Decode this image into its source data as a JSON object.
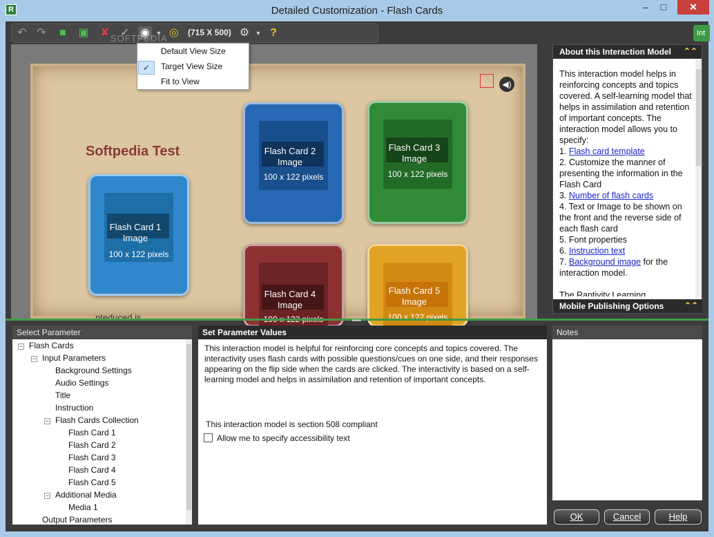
{
  "window": {
    "title": "Detailed Customization - Flash Cards",
    "icon_letter": "R",
    "min": "–",
    "max": "□",
    "close": "✕"
  },
  "toolbar": {
    "view_size": "(715 X 500)",
    "help_glyph": "?"
  },
  "side_tab": {
    "label": "Int"
  },
  "watermark": "SOFTPEDIA",
  "dropdown": {
    "items": [
      "Default View Size",
      "Target View Size",
      "Fit to View"
    ],
    "checked_index": 1,
    "check_glyph": "✓"
  },
  "canvas": {
    "project_title": "Softpedia Test",
    "hidden_text": "nteduced is",
    "speaker_glyph": "◀)",
    "cards": [
      {
        "label_line1": "Flash Card 1",
        "label_line2": "Image",
        "size": "100 x 122 pixels",
        "color": "#2f88cc"
      },
      {
        "label_line1": "Flash Card 2",
        "label_line2": "Image",
        "size": "100 x 122 pixels",
        "color": "#2869b5"
      },
      {
        "label_line1": "Flash Card 3",
        "label_line2": "Image",
        "size": "100 x 122 pixels",
        "color": "#2f8b35"
      },
      {
        "label_line1": "Flash Card 4",
        "label_line2": "Image",
        "size": "100 x 122 pixels",
        "color": "#8d3133"
      },
      {
        "label_line1": "Flash Card 5",
        "label_line2": "Image",
        "size": "100 x 122 pixels",
        "color": "#e1a323"
      }
    ]
  },
  "about": {
    "title": "About this Interaction Model",
    "intro": "This interaction model helps in reinforcing concepts and topics covered. A self-learning model that helps in assimilation and retention of important concepts. The interaction model allows you to specify:",
    "items": [
      {
        "num": "1. ",
        "link": "Flash card template",
        "text": ""
      },
      {
        "num": "2. ",
        "link": "",
        "text": "Customize the manner of presenting the information in the Flash Card"
      },
      {
        "num": "3. ",
        "link": "Number of flash cards",
        "text": ""
      },
      {
        "num": "4. ",
        "link": "",
        "text": "Text or Image to be shown on the front and the reverse side of each flash card"
      },
      {
        "num": "5. ",
        "link": "",
        "text": "Font properties"
      },
      {
        "num": "6. ",
        "link": "Instruction text",
        "text": ""
      },
      {
        "num": "7. ",
        "link": "Background image",
        "text": " for the interaction model."
      }
    ],
    "footer": "The Raptivity Learning",
    "mobile_title": "Mobile Publishing Options",
    "chevron": "⌃⌃"
  },
  "select_parameter": {
    "header": "Select Parameter",
    "tree": [
      {
        "label": "Flash Cards",
        "level": 0,
        "exp": "−"
      },
      {
        "label": "Input Parameters",
        "level": 1,
        "exp": "−"
      },
      {
        "label": "Background Settings",
        "level": 2,
        "exp": ""
      },
      {
        "label": "Audio Settings",
        "level": 2,
        "exp": ""
      },
      {
        "label": "Title",
        "level": 2,
        "exp": ""
      },
      {
        "label": "Instruction",
        "level": 2,
        "exp": ""
      },
      {
        "label": "Flash Cards Collection",
        "level": 2,
        "exp": "−"
      },
      {
        "label": "Flash Card  1",
        "level": 3,
        "exp": ""
      },
      {
        "label": "Flash Card  2",
        "level": 3,
        "exp": ""
      },
      {
        "label": "Flash Card  3",
        "level": 3,
        "exp": ""
      },
      {
        "label": "Flash Card  4",
        "level": 3,
        "exp": ""
      },
      {
        "label": "Flash Card  5",
        "level": 3,
        "exp": ""
      },
      {
        "label": "Additional Media",
        "level": 2,
        "exp": "−"
      },
      {
        "label": "Media  1",
        "level": 3,
        "exp": ""
      },
      {
        "label": "Output Parameters",
        "level": 1,
        "exp": ""
      }
    ]
  },
  "set_parameter": {
    "header": "Set Parameter Values",
    "description": "This interaction model is helpful for reinforcing core concepts and topics covered. The interactivity uses flash cards with possible questions/cues on one side, and their responses appearing on the flip side when the cards are clicked. The interactivity is based on a self-learning model and helps in assimilation and retention of important concepts.",
    "compliance": "This interaction model is section 508 compliant",
    "checkbox_label": "Allow me to specify accessibility text",
    "checkbox_checked": false
  },
  "notes": {
    "header": "Notes"
  },
  "buttons": {
    "ok": "OK",
    "cancel": "Cancel",
    "help": "Help"
  }
}
